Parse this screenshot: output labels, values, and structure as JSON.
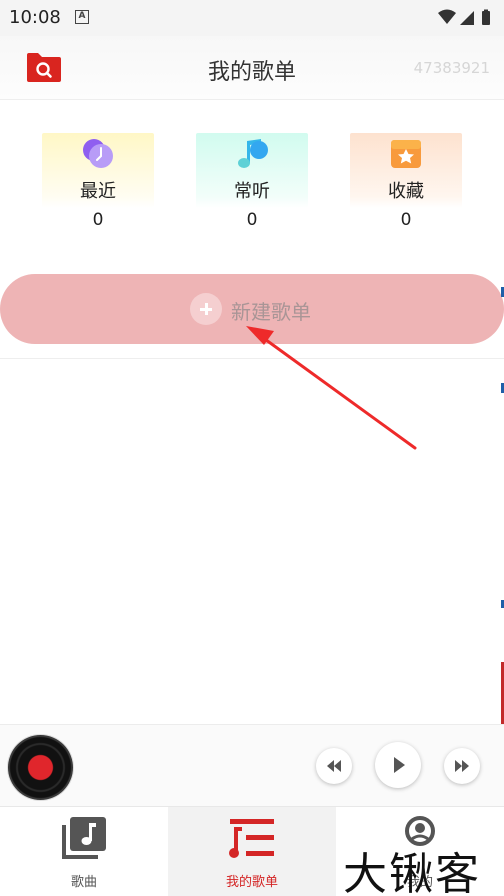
{
  "status_bar": {
    "time": "10:08",
    "notification_icon": "A"
  },
  "header": {
    "title": "我的歌单",
    "user_id": "47383921"
  },
  "quick_cards": [
    {
      "label": "最近",
      "count": "0",
      "icon": "clock-icon"
    },
    {
      "label": "常听",
      "count": "0",
      "icon": "music-note-icon"
    },
    {
      "label": "收藏",
      "count": "0",
      "icon": "star-box-icon"
    }
  ],
  "new_playlist": {
    "label": "新建歌单"
  },
  "bottom_nav": {
    "songs": "歌曲",
    "my_playlist": "我的歌单",
    "mine": "我的"
  },
  "watermark": "大锹客",
  "colors": {
    "accent": "#d42626",
    "new_button": "#eeb4b5"
  }
}
